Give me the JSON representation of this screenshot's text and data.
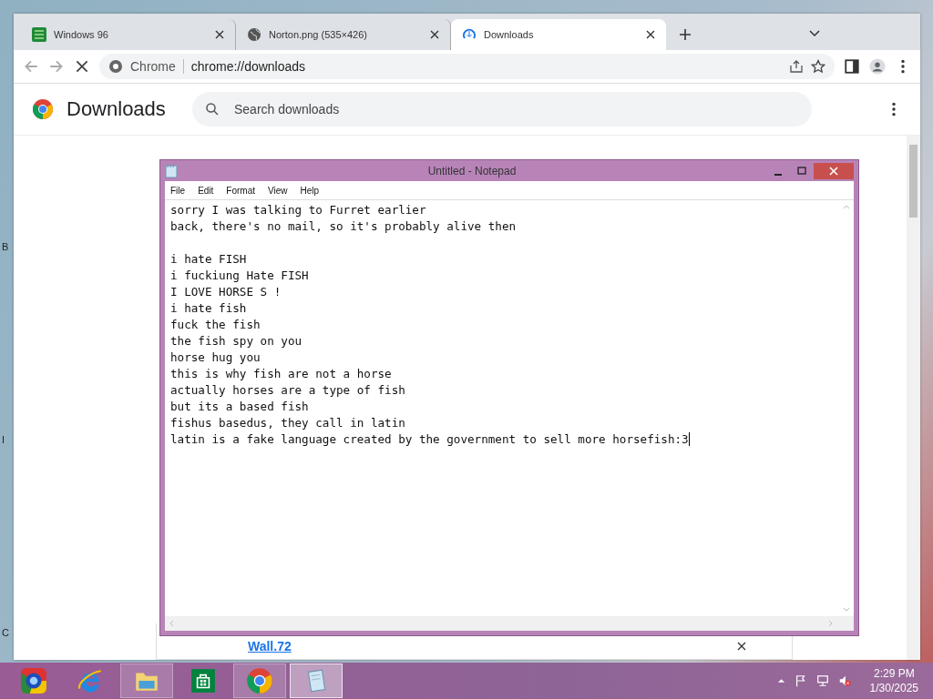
{
  "desktop": {
    "labels": [
      "B",
      "I",
      "C"
    ]
  },
  "browser": {
    "tabs": [
      {
        "kind": "site",
        "title": "Windows 96",
        "selected": false
      },
      {
        "kind": "globe",
        "title": "Norton.png (535×426)",
        "selected": false
      },
      {
        "kind": "download",
        "title": "Downloads",
        "selected": true
      }
    ],
    "address": {
      "site_label": "Chrome",
      "url": "chrome://downloads"
    },
    "page": {
      "title": "Downloads",
      "search": {
        "placeholder": "Search downloads"
      },
      "download_link": "Wall.72"
    }
  },
  "notepad": {
    "title": "Untitled - Notepad",
    "menu": [
      "File",
      "Edit",
      "Format",
      "View",
      "Help"
    ],
    "text": "sorry I was talking to Furret earlier\nback, there's no mail, so it's probably alive then\n\ni hate FISH\ni fuckiung Hate FISH\nI LOVE HORSE S !\ni hate fish\nfuck the fish\nthe fish spy on you\nhorse hug you\nthis is why fish are not a horse\nactually horses are a type of fish\nbut its a based fish\nfishus basedus, they call in latin\nlatin is a fake language created by the government to sell more horsefish:3"
  },
  "taskbar": {
    "apps": [
      {
        "kind": "ball",
        "running": false,
        "selected": false
      },
      {
        "kind": "ie",
        "running": false,
        "selected": false
      },
      {
        "kind": "folder",
        "running": true,
        "selected": false
      },
      {
        "kind": "store",
        "running": false,
        "selected": false
      },
      {
        "kind": "chrome",
        "running": true,
        "selected": false
      },
      {
        "kind": "notepad",
        "running": true,
        "selected": true
      }
    ],
    "time": "2:29 PM",
    "date": "1/30/2025"
  }
}
